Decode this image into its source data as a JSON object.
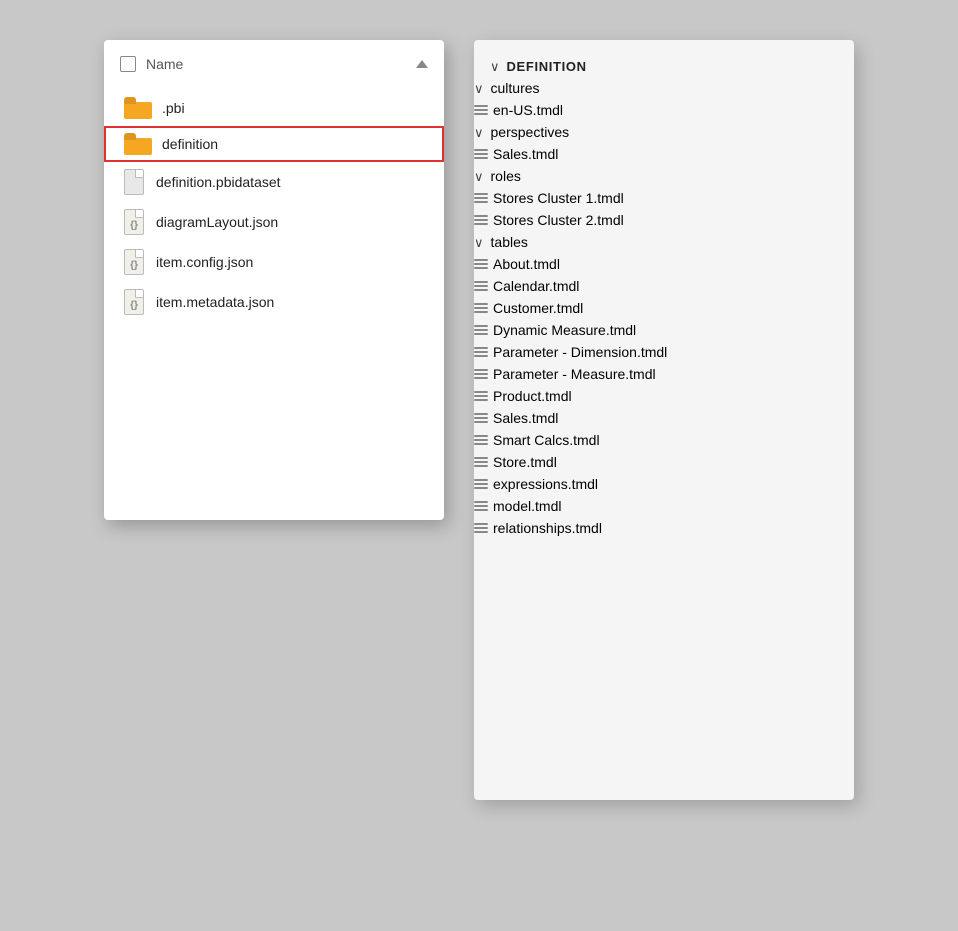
{
  "left_panel": {
    "header": {
      "checkbox_label": "",
      "name_col": "Name",
      "sort_direction": "up"
    },
    "items": [
      {
        "type": "folder",
        "label": ".pbi",
        "selected": false
      },
      {
        "type": "folder",
        "label": "definition",
        "selected": true
      },
      {
        "type": "file",
        "label": "definition.pbidataset",
        "selected": false
      },
      {
        "type": "json",
        "label": "diagramLayout.json",
        "selected": false
      },
      {
        "type": "json",
        "label": "item.config.json",
        "selected": false
      },
      {
        "type": "json",
        "label": "item.metadata.json",
        "selected": false
      }
    ]
  },
  "right_panel": {
    "root_label": "DEFINITION",
    "tree": [
      {
        "type": "group",
        "label": "cultures",
        "children": [
          {
            "type": "file",
            "label": "en-US.tmdl"
          }
        ]
      },
      {
        "type": "group",
        "label": "perspectives",
        "children": [
          {
            "type": "file",
            "label": "Sales.tmdl"
          }
        ]
      },
      {
        "type": "group",
        "label": "roles",
        "children": [
          {
            "type": "file",
            "label": "Stores Cluster 1.tmdl"
          },
          {
            "type": "file",
            "label": "Stores Cluster 2.tmdl"
          }
        ]
      },
      {
        "type": "group",
        "label": "tables",
        "children": [
          {
            "type": "file",
            "label": "About.tmdl"
          },
          {
            "type": "file",
            "label": "Calendar.tmdl"
          },
          {
            "type": "file",
            "label": "Customer.tmdl"
          },
          {
            "type": "file",
            "label": "Dynamic Measure.tmdl"
          },
          {
            "type": "file",
            "label": "Parameter - Dimension.tmdl"
          },
          {
            "type": "file",
            "label": "Parameter - Measure.tmdl"
          },
          {
            "type": "file",
            "label": "Product.tmdl"
          },
          {
            "type": "file",
            "label": "Sales.tmdl"
          },
          {
            "type": "file",
            "label": "Smart Calcs.tmdl"
          },
          {
            "type": "file",
            "label": "Store.tmdl"
          }
        ]
      },
      {
        "type": "file_root",
        "label": "expressions.tmdl"
      },
      {
        "type": "file_root",
        "label": "model.tmdl"
      },
      {
        "type": "file_root",
        "label": "relationships.tmdl"
      }
    ]
  }
}
